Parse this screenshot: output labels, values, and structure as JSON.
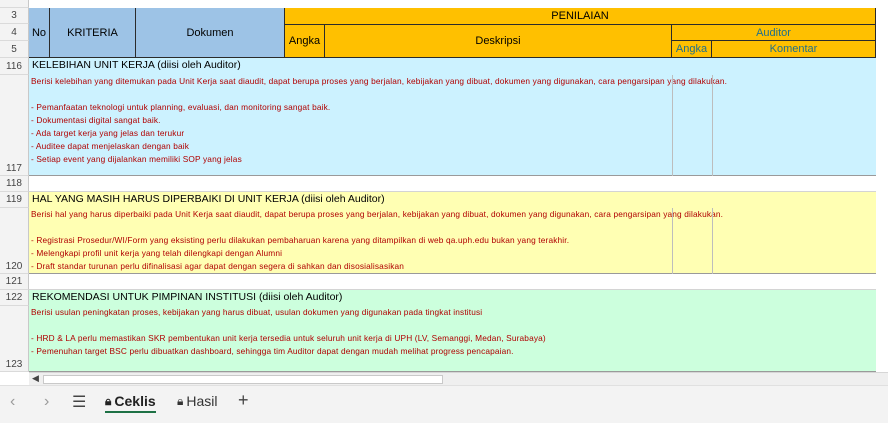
{
  "row_numbers": [
    "3",
    "4",
    "5",
    "116",
    "117",
    "118",
    "119",
    "120",
    "121",
    "122",
    "123"
  ],
  "header": {
    "no": "No",
    "kriteria": "KRITERIA",
    "dokumen": "Dokumen",
    "penilaian": "PENILAIAN",
    "angka": "Angka",
    "deskripsi": "Deskripsi",
    "auditor": "Auditor",
    "auditor_angka": "Angka",
    "komentar": "Komentar"
  },
  "sections": {
    "kelebihan": {
      "title": "KELEBIHAN UNIT KERJA (diisi oleh Auditor)",
      "lines": [
        "Berisi kelebihan yang ditemukan pada Unit Kerja saat diaudit, dapat berupa proses yang berjalan, kebijakan yang dibuat, dokumen yang digunakan, cara pengarsipan yang dilakukan.",
        "",
        "- Pemanfaatan teknologi untuk planning, evaluasi, dan monitoring sangat baik.",
        "- Dokumentasi digital sangat baik.",
        "- Ada target kerja yang jelas dan terukur",
        "- Auditee dapat menjelaskan dengan baik",
        "- Setiap event yang dijalankan memiliki SOP yang jelas"
      ]
    },
    "perbaikan": {
      "title": "HAL YANG MASIH HARUS DIPERBAIKI DI UNIT KERJA (diisi oleh Auditor)",
      "lines": [
        "Berisi hal yang harus diperbaiki pada Unit Kerja saat diaudit, dapat berupa proses yang berjalan, kebijakan yang dibuat, dokumen yang digunakan, cara pengarsipan yang dilakukan.",
        "",
        "- Registrasi Prosedur/WI/Form yang eksisting perlu dilakukan pembaharuan karena yang ditampilkan di web qa.uph.edu bukan yang terakhir.",
        "- Melengkapi profil unit kerja yang telah dilengkapi dengan Alumni",
        "- Draft standar turunan perlu difinalisasi agar dapat dengan segera di sahkan dan disosialisasikan"
      ]
    },
    "rekomendasi": {
      "title": "REKOMENDASI UNTUK PIMPINAN INSTITUSI (diisi oleh Auditor)",
      "lines": [
        "Berisi usulan peningkatan proses, kebijakan yang harus dibuat, usulan dokumen yang digunakan pada tingkat institusi",
        "",
        "- HRD & LA perlu memastikan SKR pembentukan unit kerja tersedia untuk seluruh unit kerja di UPH (LV, Semanggi, Medan, Surabaya)",
        "- Pemenuhan target BSC perlu dibuatkan dashboard, sehingga tim Auditor dapat dengan mudah melihat progress pencapaian."
      ]
    }
  },
  "sheet_tabs": [
    {
      "label": "Ceklis",
      "active": true
    },
    {
      "label": "Hasil",
      "active": false
    }
  ],
  "colors": {
    "header_blue": "#9dc3e6",
    "header_gold": "#ffc000",
    "kelebihan_bg": "#ccf2ff",
    "perbaikan_bg": "#ffffb3",
    "rekomendasi_bg": "#ccffdd",
    "body_text": "#b00000"
  }
}
